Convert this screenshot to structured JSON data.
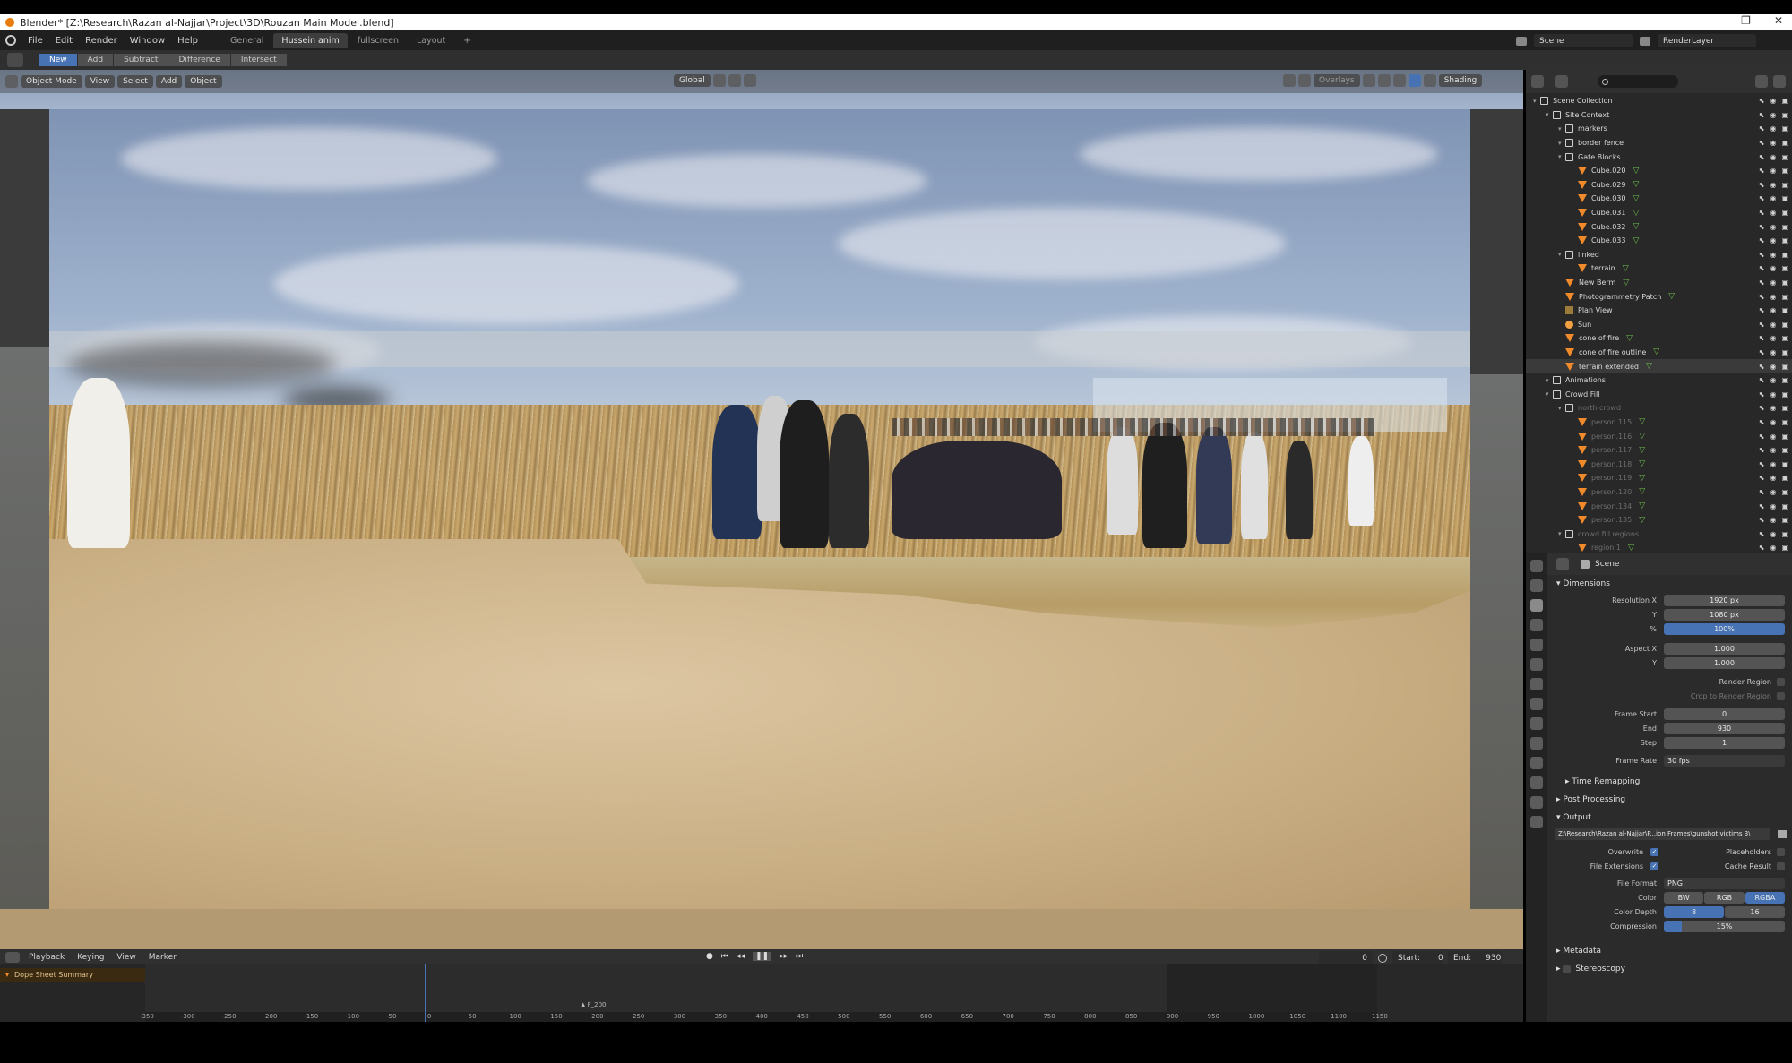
{
  "titlebar": {
    "title": "Blender* [Z:\\Research\\Razan al-Najjar\\Project\\3D\\Rouzan Main Model.blend]",
    "minimize": "–",
    "maximize": "❐",
    "close": "✕"
  },
  "menubar": {
    "items": [
      "File",
      "Edit",
      "Render",
      "Window",
      "Help"
    ],
    "workspaces": [
      "General",
      "Hussein anim",
      "fullscreen",
      "Layout"
    ],
    "active_workspace": "Hussein anim",
    "add_workspace": "+",
    "scene_name": "Scene",
    "view_layer": "RenderLayer"
  },
  "toolrow": {
    "modes": [
      "New",
      "Add",
      "Subtract",
      "Difference",
      "Intersect"
    ],
    "active_mode": "New"
  },
  "viewport_header": {
    "mode": "Object Mode",
    "menus": [
      "View",
      "Select",
      "Add",
      "Object"
    ],
    "orientation": "Global",
    "overlays": "Overlays",
    "shading": "Shading"
  },
  "outliner": {
    "search_placeholder": "",
    "rows": [
      {
        "label": "Scene Collection",
        "depth": 0,
        "icon": "collection",
        "dim": false
      },
      {
        "label": "Site Context",
        "depth": 1,
        "icon": "collection",
        "dim": false
      },
      {
        "label": "markers",
        "depth": 2,
        "icon": "collection",
        "dim": false
      },
      {
        "label": "border fence",
        "depth": 2,
        "icon": "collection",
        "dim": false
      },
      {
        "label": "Gate Blocks",
        "depth": 2,
        "icon": "collection",
        "dim": false
      },
      {
        "label": "Cube.020",
        "depth": 3,
        "icon": "mesh",
        "dim": false
      },
      {
        "label": "Cube.029",
        "depth": 3,
        "icon": "mesh",
        "dim": false
      },
      {
        "label": "Cube.030",
        "depth": 3,
        "icon": "mesh",
        "dim": false
      },
      {
        "label": "Cube.031",
        "depth": 3,
        "icon": "mesh",
        "dim": false
      },
      {
        "label": "Cube.032",
        "depth": 3,
        "icon": "mesh",
        "dim": false
      },
      {
        "label": "Cube.033",
        "depth": 3,
        "icon": "mesh",
        "dim": false
      },
      {
        "label": "linked",
        "depth": 2,
        "icon": "collection",
        "dim": false
      },
      {
        "label": "terrain",
        "depth": 3,
        "icon": "mesh",
        "dim": false
      },
      {
        "label": "New Berm",
        "depth": 2,
        "icon": "mesh",
        "dim": false
      },
      {
        "label": "Photogrammetry Patch",
        "depth": 2,
        "icon": "mesh",
        "dim": false
      },
      {
        "label": "Plan View",
        "depth": 2,
        "icon": "camera",
        "dim": false
      },
      {
        "label": "Sun",
        "depth": 2,
        "icon": "light",
        "dim": false
      },
      {
        "label": "cone of fire",
        "depth": 2,
        "icon": "mesh",
        "dim": false
      },
      {
        "label": "cone of fire outline",
        "depth": 2,
        "icon": "mesh",
        "dim": false
      },
      {
        "label": "terrain extended",
        "depth": 2,
        "icon": "mesh",
        "dim": false,
        "selected": true
      },
      {
        "label": "Animations",
        "depth": 1,
        "icon": "collection",
        "dim": false
      },
      {
        "label": "Crowd Fill",
        "depth": 1,
        "icon": "collection",
        "dim": false
      },
      {
        "label": "north crowd",
        "depth": 2,
        "icon": "collection",
        "dim": true
      },
      {
        "label": "person.115",
        "depth": 3,
        "icon": "mesh",
        "dim": true
      },
      {
        "label": "person.116",
        "depth": 3,
        "icon": "mesh",
        "dim": true
      },
      {
        "label": "person.117",
        "depth": 3,
        "icon": "mesh",
        "dim": true
      },
      {
        "label": "person.118",
        "depth": 3,
        "icon": "mesh",
        "dim": true
      },
      {
        "label": "person.119",
        "depth": 3,
        "icon": "mesh",
        "dim": true
      },
      {
        "label": "person.120",
        "depth": 3,
        "icon": "mesh",
        "dim": true
      },
      {
        "label": "person.134",
        "depth": 3,
        "icon": "mesh",
        "dim": true
      },
      {
        "label": "person.135",
        "depth": 3,
        "icon": "mesh",
        "dim": true
      },
      {
        "label": "crowd fill regions",
        "depth": 2,
        "icon": "collection",
        "dim": true
      },
      {
        "label": "region.1",
        "depth": 3,
        "icon": "mesh",
        "dim": true
      }
    ]
  },
  "properties": {
    "context": "Scene",
    "dimensions": {
      "title": "Dimensions",
      "resolution_x_label": "Resolution X",
      "resolution_x": "1920 px",
      "y_label": "Y",
      "resolution_y": "1080 px",
      "percent_label": "%",
      "percent": "100%",
      "aspect_x_label": "Aspect X",
      "aspect_x": "1.000",
      "aspect_y": "1.000",
      "render_region": "Render Region",
      "crop_region": "Crop to Render Region",
      "frame_start_label": "Frame Start",
      "frame_start": "0",
      "end_label": "End",
      "end": "930",
      "step_label": "Step",
      "step": "1",
      "frame_rate_label": "Frame Rate",
      "frame_rate": "30 fps"
    },
    "time_remapping": "Time Remapping",
    "post_processing": "Post Processing",
    "output": {
      "title": "Output",
      "path": "Z:\\Research\\Razan al-Najjar\\P...ion Frames\\gunshot victims 3\\",
      "overwrite": "Overwrite",
      "placeholders": "Placeholders",
      "file_extensions": "File Extensions",
      "cache_result": "Cache Result",
      "file_format_label": "File Format",
      "file_format": "PNG",
      "color_label": "Color",
      "color_options": [
        "BW",
        "RGB",
        "RGBA"
      ],
      "color_active": "RGBA",
      "color_depth_label": "Color Depth",
      "color_depth_options": [
        "8",
        "16"
      ],
      "compression_label": "Compression",
      "compression": "15%"
    },
    "metadata": "Metadata",
    "stereoscopy": "Stereoscopy"
  },
  "timeline": {
    "menus": [
      "Playback",
      "Keying",
      "View",
      "Marker"
    ],
    "current_frame": "0",
    "start_label": "Start:",
    "start": "0",
    "end_label": "End:",
    "end": "930",
    "channel": "Dope Sheet Summary",
    "ruler_ticks": [
      "-350",
      "-300",
      "-250",
      "-200",
      "-150",
      "-100",
      "-50",
      "0",
      "50",
      "100",
      "150",
      "200",
      "250",
      "300",
      "350",
      "400",
      "450",
      "500",
      "550",
      "600",
      "650",
      "700",
      "750",
      "800",
      "850",
      "900",
      "950",
      "1000",
      "1050",
      "1100",
      "1150"
    ],
    "marker_label": "F_200"
  },
  "colors": {
    "accent": "#4772b3",
    "object_orange": "#f08a2a",
    "data_green": "#6cbf4a"
  }
}
